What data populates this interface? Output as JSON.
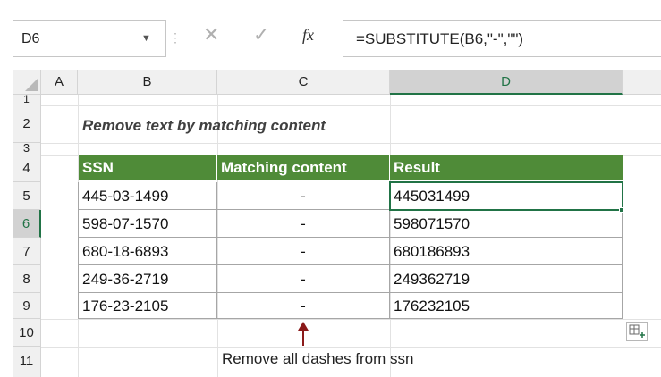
{
  "formula_bar": {
    "name_box": "D6",
    "name_box_arrow": "▼",
    "separator": "⋮",
    "cancel_icon": "✕",
    "enter_icon": "✓",
    "fx_label": "fx",
    "formula": "=SUBSTITUTE(B6,\"-\",\"\")"
  },
  "columns": [
    "A",
    "B",
    "C",
    "D"
  ],
  "selected_column": "D",
  "rows": [
    "1",
    "2",
    "3",
    "4",
    "5",
    "6",
    "7",
    "8",
    "9",
    "10",
    "11"
  ],
  "selected_row": "6",
  "title": "Remove text by matching content",
  "table": {
    "headers": [
      "SSN",
      "Matching content",
      "Result"
    ],
    "header_color": "#4f8b38",
    "rows": [
      {
        "ssn": "445-03-1499",
        "match": "-",
        "result": "445031499"
      },
      {
        "ssn": "598-07-1570",
        "match": "-",
        "result": "598071570"
      },
      {
        "ssn": "680-18-6893",
        "match": "-",
        "result": "680186893"
      },
      {
        "ssn": "249-36-2719",
        "match": "-",
        "result": "249362719"
      },
      {
        "ssn": "176-23-2105",
        "match": "-",
        "result": "176232105"
      }
    ]
  },
  "annotation": "Remove all dashes from ssn",
  "icons": {
    "paste_options": "paste-options-icon",
    "arrow": "up-arrow-icon"
  },
  "colors": {
    "accent": "#217346",
    "arrow": "#8b1a1a"
  }
}
